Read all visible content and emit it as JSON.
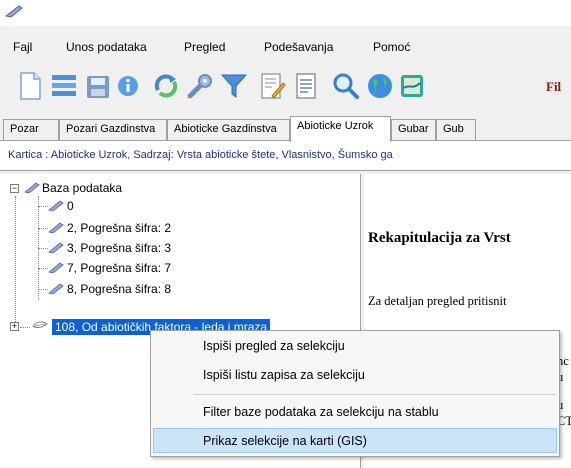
{
  "window": {
    "app_icon": "quill-icon"
  },
  "menubar": {
    "items": [
      {
        "label": "Fajl"
      },
      {
        "label": "Unos podataka"
      },
      {
        "label": "Pregled"
      },
      {
        "label": "Podešavanja"
      },
      {
        "label": "Pomoć"
      }
    ]
  },
  "toolbar": {
    "icons": [
      "new-document-icon",
      "list-icon",
      "save-icon",
      "info-icon",
      "refresh-icon",
      "settings-wrench-icon",
      "filter-icon",
      "edit-document-icon",
      "document-icon",
      "search-icon",
      "globe-icon",
      "map-icon"
    ],
    "trailing_label": "Fil"
  },
  "tabs": [
    {
      "label": "Pozar",
      "active": false
    },
    {
      "label": "Pozari Gazdinstva",
      "active": false
    },
    {
      "label": "Abioticke Gazdinstva",
      "active": false
    },
    {
      "label": "Abioticke Uzrok",
      "active": true
    },
    {
      "label": "Gubar",
      "active": false
    },
    {
      "label": "Gub",
      "active": false
    }
  ],
  "card_info": "Kartica : Abioticke Uzrok, Sadrzaj: Vrsta abioticke štete, Vlasnistvo, Šumsko ga",
  "tree": {
    "root": {
      "label": "Baza podataka",
      "expanded": true
    },
    "nodes": [
      {
        "label": "0"
      },
      {
        "label": "2, Pogrešna šifra: 2"
      },
      {
        "label": "3, Pogrešna šifra: 3"
      },
      {
        "label": "7, Pogrešna šifra: 7"
      },
      {
        "label": "8, Pogrešna šifra: 8"
      },
      {
        "label": "108, Od abiotičkih faktora - leda i mraza",
        "selected": true,
        "expandable": true
      }
    ]
  },
  "preview": {
    "title": "Rekapitulacija za Vrst",
    "text": "Za detaljan pregled pritisnit",
    "snippets": [
      "nc",
      "u",
      "u",
      "CT"
    ]
  },
  "context_menu": {
    "items": [
      {
        "label": "Ispiši pregled za selekciju"
      },
      {
        "label": "Ispiši listu zapisa za selekciju"
      },
      {
        "label": "Filter baze podataka za selekciju na stablu"
      },
      {
        "label": "Prikaz selekcije na karti (GIS)",
        "highlighted": true
      }
    ]
  },
  "colors": {
    "selection": "#0a62d6",
    "card_info_text": "#1e2f8a",
    "menu_highlight": "#cce4f7",
    "toolbar_label": "#8b1a1a"
  }
}
